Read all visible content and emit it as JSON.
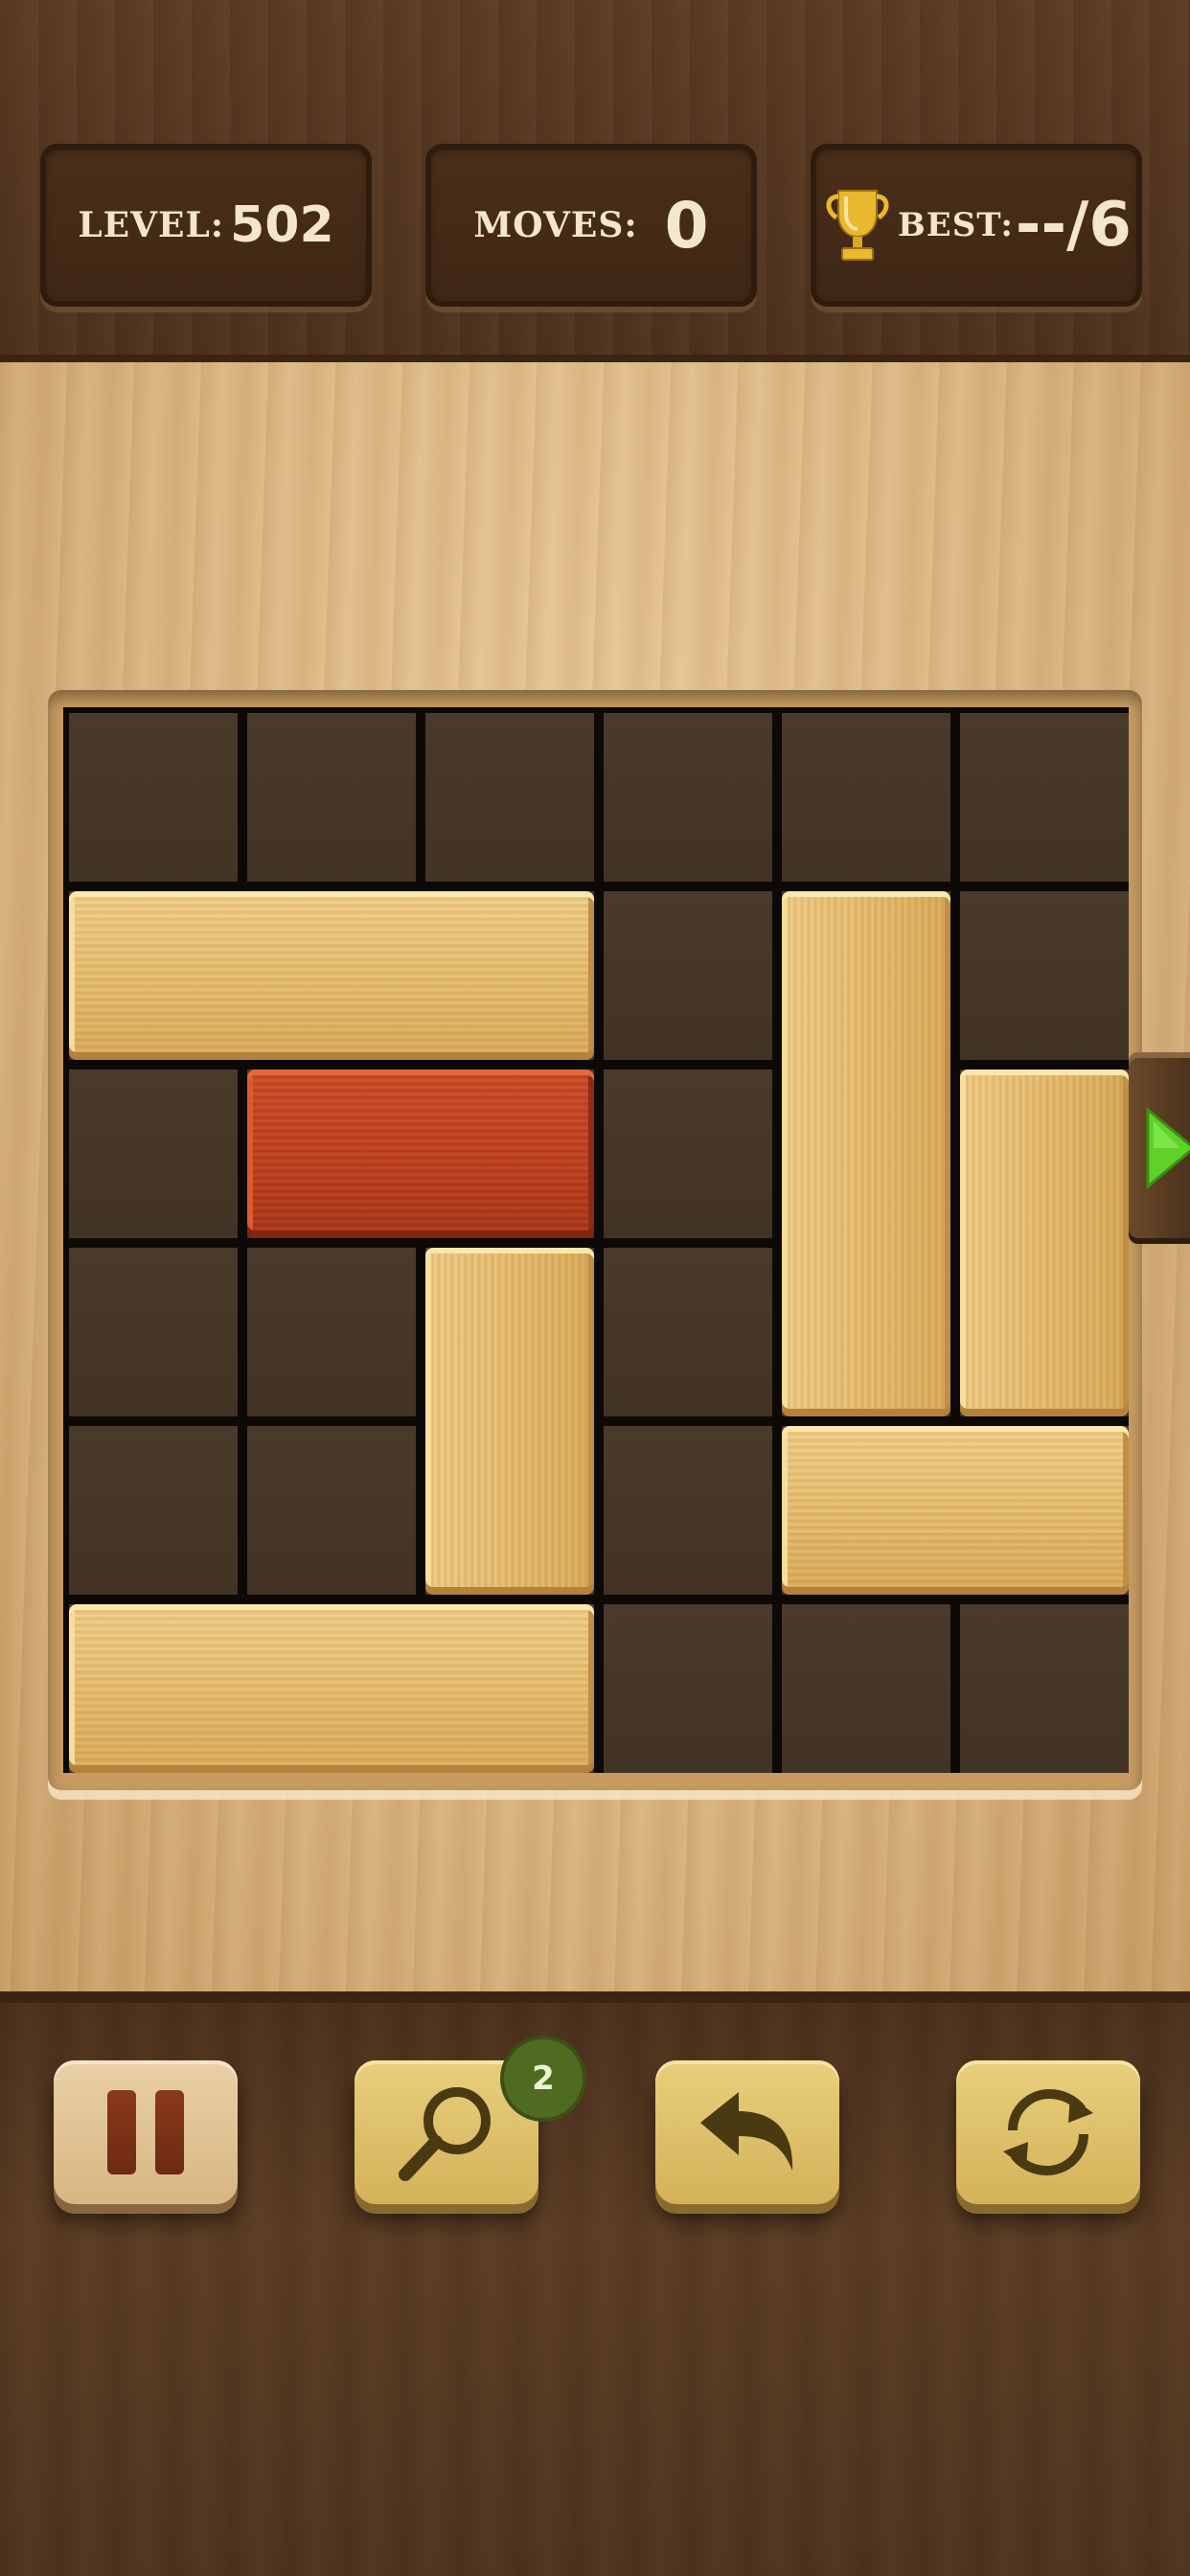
{
  "header": {
    "level": {
      "label": "LEVEL:",
      "value": "502"
    },
    "moves": {
      "label": "MOVES:",
      "value": "0"
    },
    "best": {
      "label": "BEST:",
      "value": "--/6",
      "icon": "trophy-icon"
    }
  },
  "board": {
    "rows": 6,
    "cols": 6,
    "blocks": [
      {
        "id": "wood-h-1",
        "kind": "wood",
        "orientation": "horizontal",
        "row": 1,
        "col": 0,
        "length": 3
      },
      {
        "id": "red-target",
        "kind": "target",
        "orientation": "horizontal",
        "row": 2,
        "col": 1,
        "length": 2
      },
      {
        "id": "wood-v-1",
        "kind": "wood",
        "orientation": "vertical",
        "row": 1,
        "col": 4,
        "length": 3
      },
      {
        "id": "wood-v-2",
        "kind": "wood",
        "orientation": "vertical",
        "row": 2,
        "col": 5,
        "length": 2
      },
      {
        "id": "wood-v-3",
        "kind": "wood",
        "orientation": "vertical",
        "row": 3,
        "col": 2,
        "length": 2
      },
      {
        "id": "wood-h-2",
        "kind": "wood",
        "orientation": "horizontal",
        "row": 4,
        "col": 4,
        "length": 2
      },
      {
        "id": "wood-h-3",
        "kind": "wood",
        "orientation": "horizontal",
        "row": 5,
        "col": 0,
        "length": 3
      }
    ],
    "exit": {
      "row": 2,
      "side": "right",
      "icon": "play-arrow-icon"
    }
  },
  "toolbar": {
    "pause": {
      "icon": "pause-icon"
    },
    "hint": {
      "icon": "magnifier-icon",
      "badge": "2"
    },
    "undo": {
      "icon": "undo-arrow-icon"
    },
    "restart": {
      "icon": "restart-icon"
    }
  },
  "colors": {
    "target_block": "#c13f1c",
    "wood_block": "#e7bd6d",
    "exit_arrow": "#5fd12a",
    "hint_badge": "#4f6b1f"
  }
}
